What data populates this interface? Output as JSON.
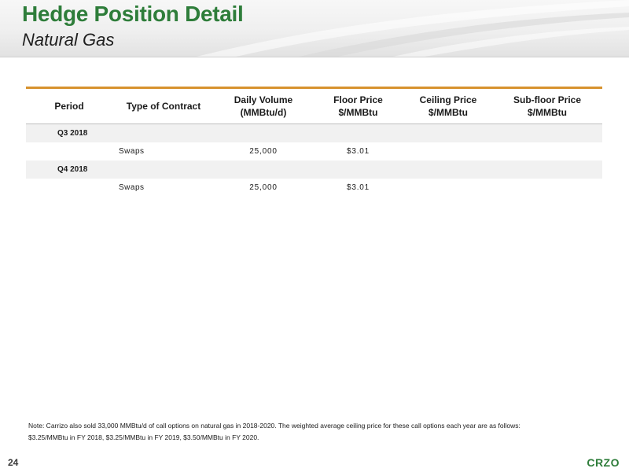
{
  "header": {
    "title": "Hedge Position Detail",
    "subtitle": "Natural Gas"
  },
  "table": {
    "columns": [
      {
        "line1": "Period",
        "line2": ""
      },
      {
        "line1": "Type of Contract",
        "line2": ""
      },
      {
        "line1": "Daily Volume",
        "line2": "(MMBtu/d)"
      },
      {
        "line1": "Floor Price",
        "line2": "$/MMBtu"
      },
      {
        "line1": "Ceiling Price",
        "line2": "$/MMBtu"
      },
      {
        "line1": "Sub-floor Price",
        "line2": "$/MMBtu"
      }
    ],
    "groups": [
      {
        "period": "Q3 2018",
        "rows": [
          {
            "type": "Swaps",
            "daily_volume": "25,000",
            "floor_price": "$3.01",
            "ceiling_price": "",
            "subfloor_price": ""
          }
        ]
      },
      {
        "period": "Q4 2018",
        "rows": [
          {
            "type": "Swaps",
            "daily_volume": "25,000",
            "floor_price": "$3.01",
            "ceiling_price": "",
            "subfloor_price": ""
          }
        ]
      }
    ]
  },
  "note": {
    "line1": "Note: Carrizo also sold 33,000 MMBtu/d of call options on natural gas in 2018-2020. The weighted average ceiling price for these call options each year are as follows:",
    "line2": "$3.25/MMBtu in FY 2018, $3.25/MMBtu in FY 2019, $3.50/MMBtu in FY 2020."
  },
  "footer": {
    "page_number": "24",
    "logo_text": "CRZO"
  },
  "colors": {
    "title_green": "#2e7d3a",
    "table_rule_orange": "#d7922e",
    "period_row_bg": "#f1f1f1"
  }
}
